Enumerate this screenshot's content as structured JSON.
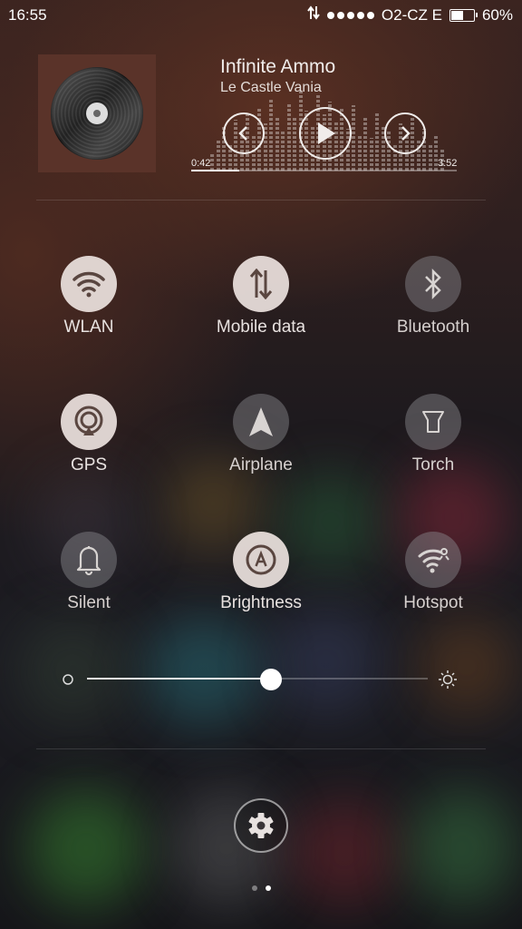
{
  "status_bar": {
    "time": "16:55",
    "carrier": "O2-CZ E",
    "battery_percent": "60%",
    "battery_level": 0.6,
    "signal_dots": 5
  },
  "music": {
    "title": "Infinite Ammo",
    "artist": "Le Castle Vania",
    "elapsed": "0:42",
    "duration": "3:52",
    "progress": 0.18
  },
  "toggles": [
    {
      "label": "WLAN",
      "icon": "wifi-icon",
      "on": true
    },
    {
      "label": "Mobile data",
      "icon": "mobile-data-icon",
      "on": true
    },
    {
      "label": "Bluetooth",
      "icon": "bluetooth-icon",
      "on": false
    },
    {
      "label": "GPS",
      "icon": "gps-icon",
      "on": true
    },
    {
      "label": "Airplane",
      "icon": "airplane-icon",
      "on": false
    },
    {
      "label": "Torch",
      "icon": "torch-icon",
      "on": false
    },
    {
      "label": "Silent",
      "icon": "bell-icon",
      "on": false
    },
    {
      "label": "Brightness",
      "icon": "auto-brightness-icon",
      "on": true
    },
    {
      "label": "Hotspot",
      "icon": "hotspot-icon",
      "on": false
    }
  ],
  "brightness": {
    "level": 0.54
  },
  "pager": {
    "pages": 2,
    "current": 1
  },
  "colors": {
    "toggle_on": "#ece2de",
    "toggle_off": "#8c8c91",
    "icon_dark": "#5a4640"
  }
}
